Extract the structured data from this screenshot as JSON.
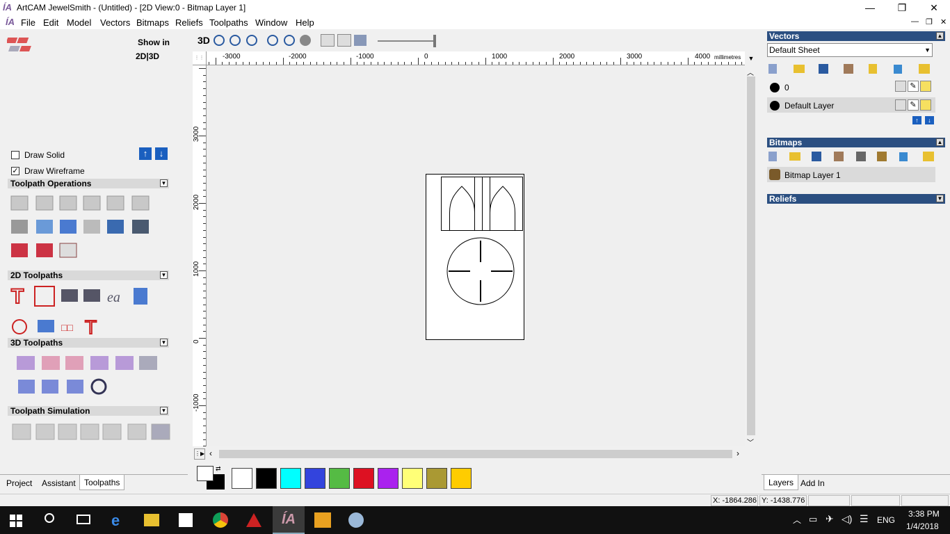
{
  "window": {
    "title": "ArtCAM JewelSmith - (Untitled) - [2D View:0 - Bitmap Layer 1]",
    "minimize": "—",
    "maximize": "❐",
    "close": "✕"
  },
  "menu": [
    "File",
    "Edit",
    "Model",
    "Vectors",
    "Bitmaps",
    "Reliefs",
    "Toolpaths",
    "Window",
    "Help"
  ],
  "left": {
    "show_in": "Show in",
    "show_in_mode": "2D|3D",
    "draw_solid": "Draw Solid",
    "draw_wireframe": "Draw Wireframe",
    "draw_wireframe_checked": true,
    "sections": [
      "Toolpath Operations",
      "2D Toolpaths",
      "3D Toolpaths",
      "Toolpath Simulation"
    ],
    "tabs": [
      "Project",
      "Assistant",
      "Toolpaths"
    ],
    "active_tab": "Toolpaths"
  },
  "view": {
    "mode_label": "3D",
    "ruler_units": "millimetres",
    "x_ticks": [
      "-3000",
      "-2000",
      "-1000",
      "0",
      "1000",
      "2000",
      "3000",
      "4000"
    ],
    "y_ticks": [
      "3000",
      "2000",
      "1000",
      "0",
      "-1000"
    ]
  },
  "palette": {
    "colors": [
      "#ffffff",
      "#000000",
      "#00ffff",
      "#3344dd",
      "#55bb44",
      "#dd1122",
      "#aa22ee",
      "#ffff77",
      "#aa9933",
      "#ffcc00"
    ]
  },
  "right": {
    "vectors_title": "Vectors",
    "sheet_select": "Default Sheet",
    "layers": [
      {
        "name": "0"
      },
      {
        "name": "Default Layer"
      }
    ],
    "bitmaps_title": "Bitmaps",
    "bitmap_layer": "Bitmap Layer 1",
    "reliefs_title": "Reliefs",
    "tabs": [
      "Layers",
      "Add In"
    ],
    "active_tab": "Layers"
  },
  "status": {
    "x": "X: -1864.286",
    "y": "Y: -1438.776"
  },
  "taskbar": {
    "lang": "ENG",
    "time": "3:38 PM",
    "date": "1/4/2018"
  }
}
